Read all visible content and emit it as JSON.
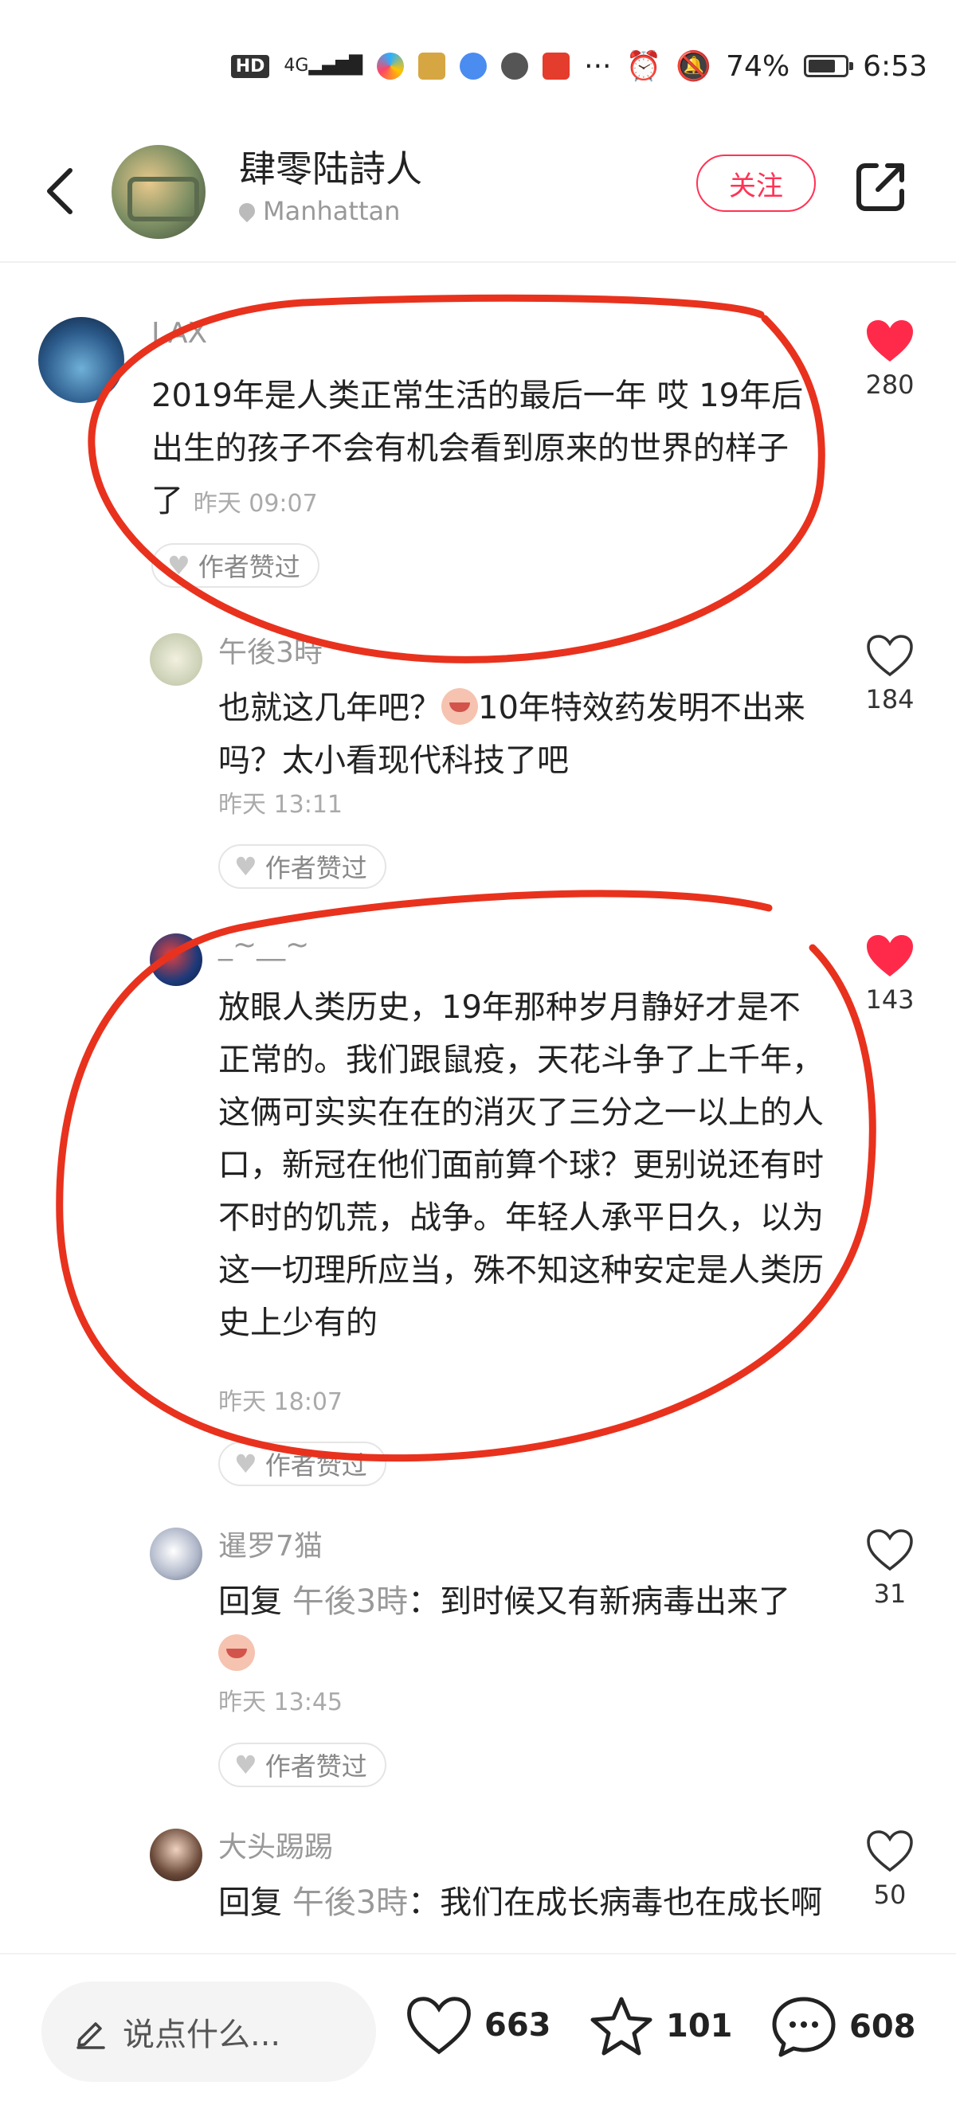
{
  "status_bar": {
    "hd": "HD",
    "network": "4G",
    "battery_percent": "74%",
    "battery_level": 0.74,
    "time": "6:53",
    "icons": [
      "hd-icon",
      "signal-icon",
      "app-icon",
      "app-icon",
      "app-icon",
      "wechat-icon",
      "weibo-icon",
      "more-icon",
      "alarm-icon",
      "mute-icon",
      "battery-icon"
    ]
  },
  "header": {
    "author": "肆零陆詩人",
    "location": "Manhattan",
    "follow_label": "关注",
    "icons": [
      "back-icon",
      "location-pin-icon",
      "share-icon"
    ]
  },
  "comments": [
    {
      "user": "LAX",
      "text": "2019年是人类正常生活的最后一年 哎 19年后出生的孩子不会有机会看到原来的世界的样子了",
      "time": "昨天 09:07",
      "author_liked": "作者赞过",
      "likes": "280",
      "liked": true
    },
    {
      "user": "午後3時",
      "text_before_emoji": "也就这几年吧？",
      "text_after_emoji": "10年特效药发明不出来吗？太小看现代科技了吧",
      "time": "昨天 13:11",
      "author_liked": "作者赞过",
      "likes": "184",
      "liked": false
    },
    {
      "user": "_~__~",
      "text": "放眼人类历史，19年那种岁月静好才是不正常的。我们跟鼠疫，天花斗争了上千年，这俩可实实在在的消灭了三分之一以上的人口，新冠在他们面前算个球？更别说还有时不时的饥荒，战争。年轻人承平日久，以为这一切理所应当，殊不知这种安定是人类历史上少有的",
      "time": "昨天 18:07",
      "author_liked": "作者赞过",
      "likes": "143",
      "liked": true
    },
    {
      "user": "暹罗7猫",
      "reply_prefix": "回复 ",
      "reply_to": "午後3時",
      "text": "：到时候又有新病毒出来了",
      "time": "昨天 13:45",
      "author_liked": "作者赞过",
      "likes": "31",
      "liked": false
    },
    {
      "user": "大头踢踢",
      "reply_prefix": "回复 ",
      "reply_to": "午後3時",
      "text": "：我们在成长病毒也在成长啊",
      "likes": "50",
      "liked": false
    }
  ],
  "bottom_bar": {
    "placeholder": "说点什么...",
    "likes": "663",
    "favorites": "101",
    "comments": "608"
  },
  "colors": {
    "accent": "#ff3355",
    "heart_filled": "#ff2a4a",
    "annotation_red": "#e8321e"
  }
}
